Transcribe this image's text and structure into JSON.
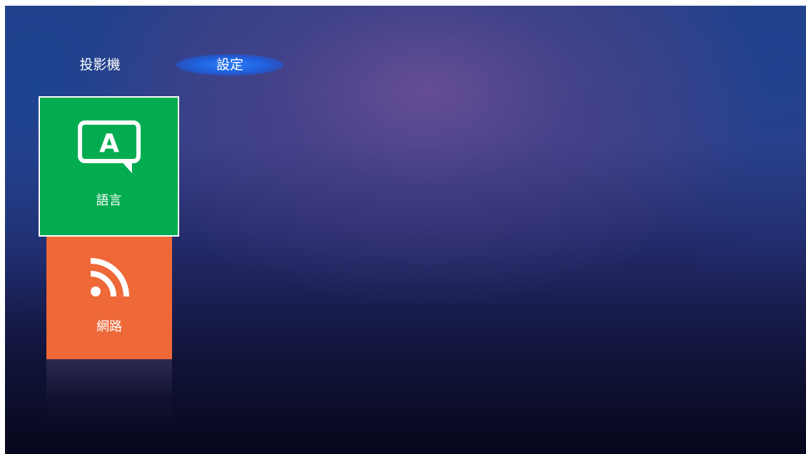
{
  "nav": {
    "items": [
      {
        "label": "投影機",
        "selected": false
      },
      {
        "label": "設定",
        "selected": true
      }
    ]
  },
  "tiles": [
    {
      "label": "語言",
      "icon": "language-bubble-icon",
      "color": "#03ac50",
      "focused": true
    },
    {
      "label": "網路",
      "icon": "rss-wifi-icon",
      "color": "#ee6838",
      "focused": false
    }
  ],
  "colors": {
    "nav_highlight": "#2f7cf4",
    "focus_border": "#ffffff"
  }
}
